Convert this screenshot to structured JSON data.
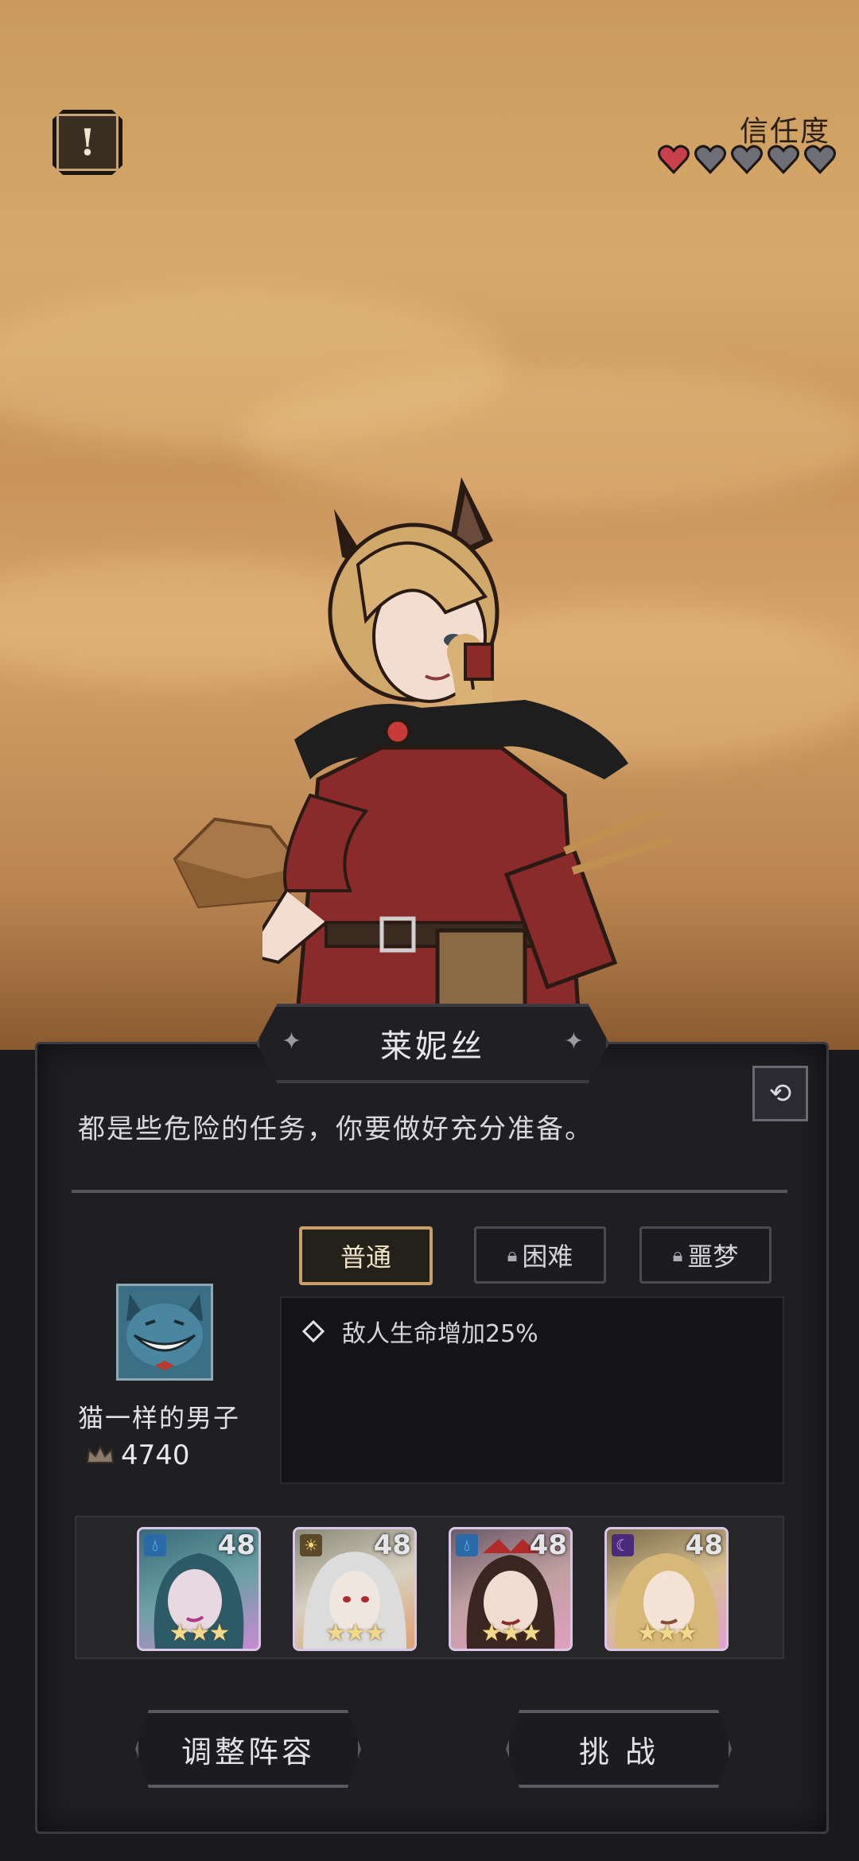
{
  "header": {
    "alert_icon": "exclamation",
    "trust_label": "信任度",
    "trust_hearts": {
      "filled": 1,
      "total": 5
    },
    "heart_filled_color": "#c8404c",
    "heart_empty_color": "#6e6e76"
  },
  "character": {
    "name": "莱妮丝"
  },
  "dialog": {
    "text": "都是些危险的任务，你要做好充分准备。"
  },
  "difficulty": {
    "tabs": [
      {
        "label": "普通",
        "active": true,
        "locked": false
      },
      {
        "label": "困难",
        "active": false,
        "locked": true
      },
      {
        "label": "噩梦",
        "active": false,
        "locked": true
      }
    ]
  },
  "effects": [
    {
      "text": "敌人生命增加25%"
    }
  ],
  "enemy": {
    "name": "猫一样的男子",
    "power": "4740"
  },
  "team": [
    {
      "level": "48",
      "element": "water-icon",
      "stars": 3
    },
    {
      "level": "48",
      "element": "sun-icon",
      "stars": 3
    },
    {
      "level": "48",
      "element": "water-icon",
      "stars": 3
    },
    {
      "level": "48",
      "element": "moon-icon",
      "stars": 3
    }
  ],
  "buttons": {
    "adjust": "调整阵容",
    "challenge": "挑 战"
  },
  "colors": {
    "accent_gold": "#c9a06a",
    "panel_bg": "#1f1f22"
  }
}
